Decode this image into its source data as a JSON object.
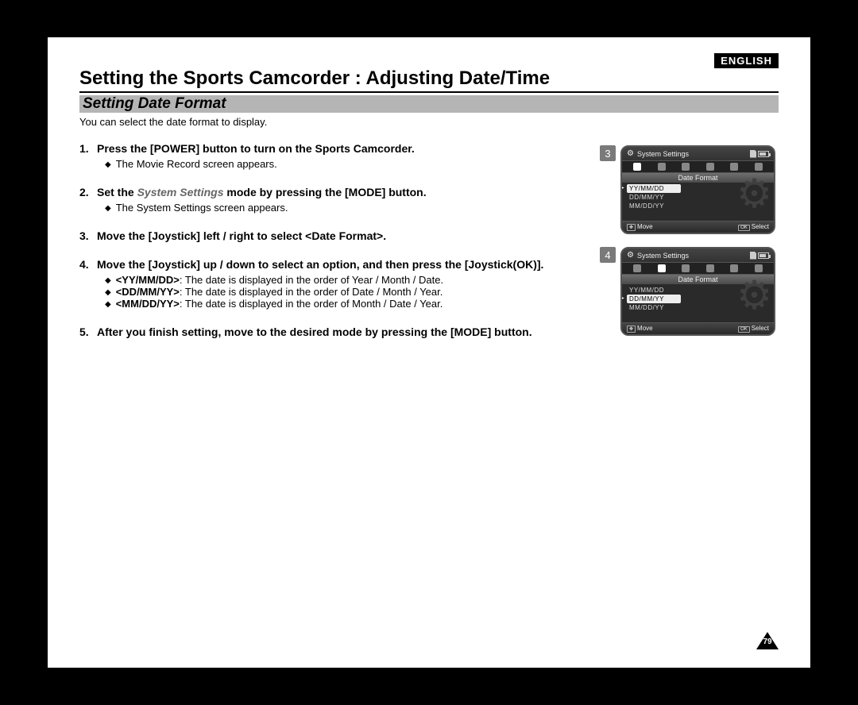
{
  "language_badge": "ENGLISH",
  "page_title": "Setting the Sports Camcorder : Adjusting Date/Time",
  "section_title": "Setting Date Format",
  "intro": "You can select the date format to display.",
  "steps": [
    {
      "title_pre": "Press the [POWER] button to turn on the Sports Camcorder.",
      "sub": [
        "The Movie Record screen appears."
      ]
    },
    {
      "title_pre": "Set the ",
      "title_em": "System Settings",
      "title_post": " mode by pressing the [MODE] button.",
      "sub": [
        "The System Settings screen appears."
      ]
    },
    {
      "title_pre": "Move the [Joystick] left / right to select <Date Format>."
    },
    {
      "title_pre": "Move the [Joystick] up / down to select an option, and then press the [Joystick(OK)].",
      "sub_rich": [
        {
          "b": "<YY/MM/DD>",
          "t": ": The date is displayed in the order of Year / Month / Date."
        },
        {
          "b": "<DD/MM/YY>",
          "t": ": The date is displayed in the order of Date / Month / Year."
        },
        {
          "b": "<MM/DD/YY>",
          "t": ": The date is displayed in the order of Month / Date / Year."
        }
      ]
    },
    {
      "title_pre": "After you finish setting, move to the desired mode by pressing the [MODE] button."
    }
  ],
  "screenshots": [
    {
      "num": "3",
      "header": "System Settings",
      "section": "Date Format",
      "options": [
        "YY/MM/DD",
        "DD/MM/YY",
        "MM/DD/YY"
      ],
      "selected_index": 0,
      "foot_move": "Move",
      "foot_select": "Select"
    },
    {
      "num": "4",
      "header": "System Settings",
      "section": "Date Format",
      "options": [
        "YY/MM/DD",
        "DD/MM/YY",
        "MM/DD/YY"
      ],
      "selected_index": 1,
      "foot_move": "Move",
      "foot_select": "Select"
    }
  ],
  "page_number": "79"
}
